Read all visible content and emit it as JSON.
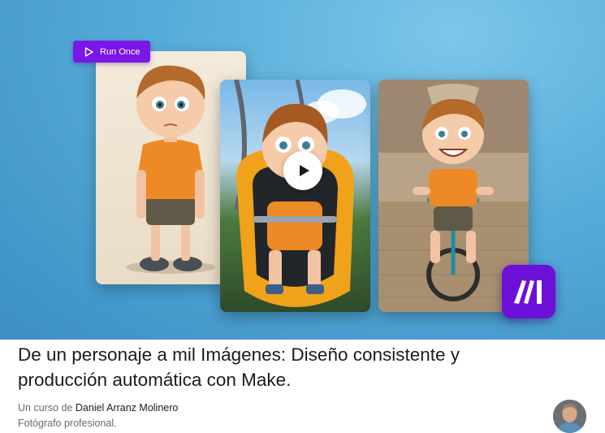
{
  "hero": {
    "run_button_label": "Run Once",
    "play_icon": "play-icon",
    "logo_icon": "make-logo-icon",
    "colors": {
      "accent": "#7b16e6",
      "logo_bg": "#6d10d8",
      "hero_bg": "#56acd9"
    }
  },
  "course": {
    "title": "De un personaje a mil Imágenes: Diseño consistente y producción automática con Make.",
    "byline_prefix": "Un curso de",
    "author": "Daniel Arranz Molinero",
    "role": "Fotógrafo profesional."
  }
}
